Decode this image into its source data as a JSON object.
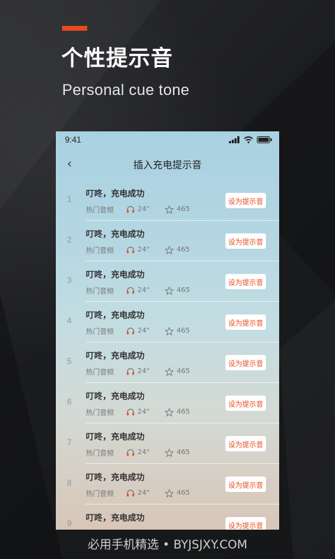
{
  "colors": {
    "accent": "#e8491d",
    "button_text": "#e8491d"
  },
  "headline": "个性提示音",
  "subhead": "Personal cue tone",
  "phone": {
    "status_time": "9:41",
    "nav_title": "插入充电提示音",
    "back_icon": "chevron-left-icon",
    "rows": [
      {
        "num": "1",
        "title": "叮咚，充电成功",
        "category": "热门音频",
        "duration": "24\"",
        "favorites": "465",
        "button": "设为提示音"
      },
      {
        "num": "2",
        "title": "叮咚，充电成功",
        "category": "热门音频",
        "duration": "24\"",
        "favorites": "465",
        "button": "设为提示音"
      },
      {
        "num": "3",
        "title": "叮咚，充电成功",
        "category": "热门音频",
        "duration": "24\"",
        "favorites": "465",
        "button": "设为提示音"
      },
      {
        "num": "4",
        "title": "叮咚，充电成功",
        "category": "热门音频",
        "duration": "24\"",
        "favorites": "465",
        "button": "设为提示音"
      },
      {
        "num": "5",
        "title": "叮咚，充电成功",
        "category": "热门音频",
        "duration": "24\"",
        "favorites": "465",
        "button": "设为提示音"
      },
      {
        "num": "6",
        "title": "叮咚，充电成功",
        "category": "热门音频",
        "duration": "24\"",
        "favorites": "465",
        "button": "设为提示音"
      },
      {
        "num": "7",
        "title": "叮咚，充电成功",
        "category": "热门音频",
        "duration": "24\"",
        "favorites": "465",
        "button": "设为提示音"
      },
      {
        "num": "8",
        "title": "叮咚，充电成功",
        "category": "热门音频",
        "duration": "24\"",
        "favorites": "465",
        "button": "设为提示音"
      },
      {
        "num": "9",
        "title": "叮咚，充电成功",
        "category": "",
        "duration": "",
        "favorites": "",
        "button": "设为提示音"
      }
    ]
  },
  "footer": "必用手机精选 • BYJSJXY.COM"
}
